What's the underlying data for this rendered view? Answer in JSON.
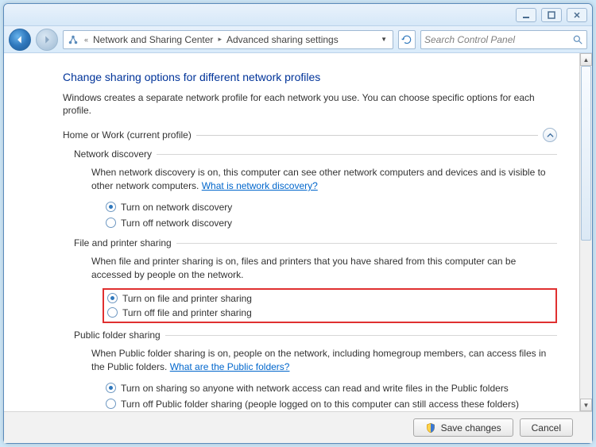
{
  "titlebar": {
    "title": ""
  },
  "address": {
    "crumb1": "Network and Sharing Center",
    "crumb2": "Advanced sharing settings"
  },
  "search": {
    "placeholder": "Search Control Panel"
  },
  "page": {
    "title": "Change sharing options for different network profiles",
    "intro": "Windows creates a separate network profile for each network you use. You can choose specific options for each profile."
  },
  "profile": {
    "label": "Home or Work (current profile)"
  },
  "netdisc": {
    "header": "Network discovery",
    "desc": "When network discovery is on, this computer can see other network computers and devices and is visible to other network computers. ",
    "link": "What is network discovery?",
    "opt_on": "Turn on network discovery",
    "opt_off": "Turn off network discovery"
  },
  "fps": {
    "header": "File and printer sharing",
    "desc": "When file and printer sharing is on, files and printers that you have shared from this computer can be accessed by people on the network.",
    "opt_on": "Turn on file and printer sharing",
    "opt_off": "Turn off file and printer sharing"
  },
  "pfs": {
    "header": "Public folder sharing",
    "desc": "When Public folder sharing is on, people on the network, including homegroup members, can access files in the Public folders. ",
    "link": "What are the Public folders?",
    "opt_on": "Turn on sharing so anyone with network access can read and write files in the Public folders",
    "opt_off": "Turn off Public folder sharing (people logged on to this computer can still access these folders)"
  },
  "footer": {
    "save": "Save changes",
    "cancel": "Cancel"
  }
}
